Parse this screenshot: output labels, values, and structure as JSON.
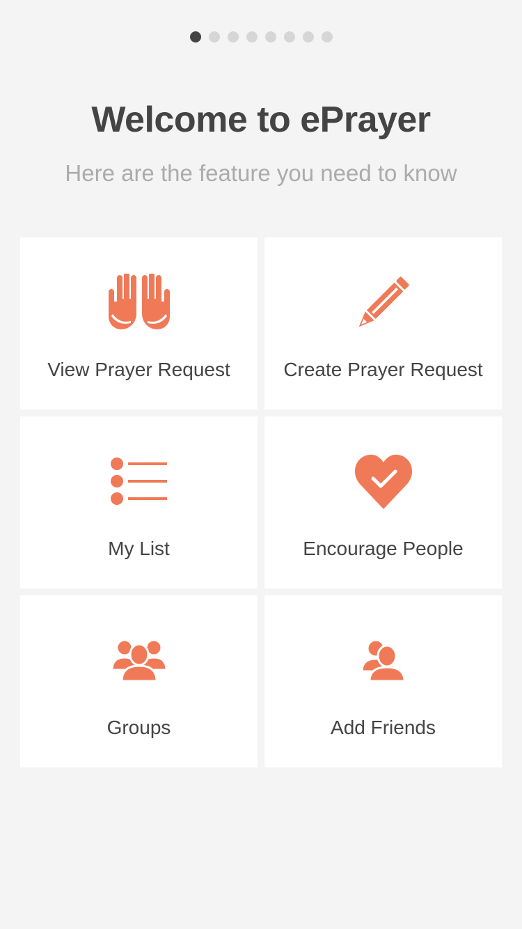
{
  "pager": {
    "total": 8,
    "active_index": 0
  },
  "header": {
    "title": "Welcome to ePrayer",
    "subtitle": "Here are the feature you need to know"
  },
  "colors": {
    "accent": "#f07a57",
    "background": "#f4f4f4",
    "card": "#ffffff",
    "title_text": "#444444",
    "subtitle_text": "#ababab",
    "dot_active": "#444444",
    "dot_inactive": "#d6d6d6"
  },
  "features": [
    {
      "label": "View Prayer Request",
      "icon": "praying-hands-icon"
    },
    {
      "label": "Create Prayer Request",
      "icon": "pencil-icon"
    },
    {
      "label": "My List",
      "icon": "list-icon"
    },
    {
      "label": "Encourage People",
      "icon": "heart-check-icon"
    },
    {
      "label": "Groups",
      "icon": "group-icon"
    },
    {
      "label": "Add Friends",
      "icon": "friends-icon"
    }
  ]
}
